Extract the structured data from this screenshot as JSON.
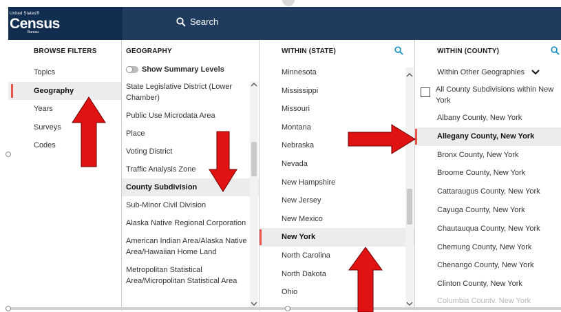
{
  "header": {
    "logo_line1": "United States®",
    "logo_line2": "Census",
    "logo_line3": "Bureau",
    "search_label": "Search"
  },
  "browse": {
    "title": "BROWSE FILTERS",
    "items": [
      "Topics",
      "Geography",
      "Years",
      "Surveys",
      "Codes"
    ],
    "selected": "Geography"
  },
  "geography": {
    "title": "GEOGRAPHY",
    "toggle_label": "Show Summary Levels",
    "items": [
      "State Legislative District (Lower Chamber)",
      "Public Use Microdata Area",
      "Place",
      "Voting District",
      "Traffic Analysis Zone",
      "County Subdivision",
      "Sub-Minor Civil Division",
      "Alaska Native Regional Corporation",
      "American Indian Area/Alaska Native Area/Hawaiian Home Land",
      "Metropolitan Statistical Area/Micropolitan Statistical Area"
    ],
    "selected": "County Subdivision"
  },
  "state": {
    "title": "WITHIN (STATE)",
    "items": [
      "Minnesota",
      "Mississippi",
      "Missouri",
      "Montana",
      "Nebraska",
      "Nevada",
      "New Hampshire",
      "New Jersey",
      "New Mexico",
      "New York",
      "North Carolina",
      "North Dakota",
      "Ohio"
    ],
    "selected": "New York"
  },
  "county": {
    "title": "WITHIN (COUNTY)",
    "dropdown_label": "Within Other Geographies",
    "checkbox_label": "All County Subdivisions within New York",
    "items": [
      "Albany County, New York",
      "Allegany County, New York",
      "Bronx County, New York",
      "Broome County, New York",
      "Cattaraugus County, New York",
      "Cayuga County, New York",
      "Chautauqua County, New York",
      "Chemung County, New York",
      "Chenango County, New York",
      "Clinton County, New York",
      "Columbia County, New York"
    ],
    "selected": "Allegany County, New York"
  },
  "colors": {
    "header_bg": "#1f3b5d",
    "logo_bg": "#112e51",
    "selection_marker": "#e8554d",
    "arrow": "#e01212",
    "search_icon": "#1a8fbf"
  },
  "icons": {
    "search": "magnifier-icon",
    "dropdown": "chevron-down-icon",
    "scroll_up": "chevron-up-icon",
    "scroll_down": "chevron-down-icon"
  }
}
